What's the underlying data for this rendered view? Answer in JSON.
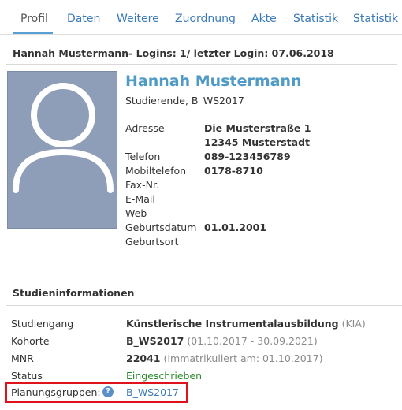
{
  "tabs": [
    {
      "label": "Profil",
      "active": true
    },
    {
      "label": "Daten"
    },
    {
      "label": "Weitere"
    },
    {
      "label": "Zuordnung"
    },
    {
      "label": "Akte"
    },
    {
      "label": "Statistik"
    },
    {
      "label": "Statistik"
    }
  ],
  "header": {
    "title": "Hannah Mustermann- Logins: 1/ letzter Login: 07.06.2018"
  },
  "profile": {
    "name": "Hannah Mustermann",
    "subtitle": "Studierende, B_WS2017",
    "avatar_icon": "user-silhouette-icon",
    "details": [
      {
        "label": "Adresse",
        "value": "Die Musterstraße 1"
      },
      {
        "label": "",
        "value": "12345 Musterstadt"
      },
      {
        "label": "Telefon",
        "value": "089-123456789"
      },
      {
        "label": "Mobiltelefon",
        "value": "0178-8710"
      },
      {
        "label": "Fax-Nr.",
        "value": ""
      },
      {
        "label": "E-Mail",
        "value": ""
      },
      {
        "label": "Web",
        "value": ""
      },
      {
        "label": "Geburtsdatum",
        "value": "01.01.2001"
      },
      {
        "label": "Geburtsort",
        "value": ""
      }
    ]
  },
  "studieninfo": {
    "title": "Studieninformationen",
    "studiengang": {
      "label": "Studiengang",
      "value": "Künstlerische Instrumentalausbildung",
      "extra": "(KIA)"
    },
    "kohorte": {
      "label": "Kohorte",
      "value": "B_WS2017",
      "extra": "(01.10.2017 - 30.09.2021)"
    },
    "mnr": {
      "label": "MNR",
      "value": "22041",
      "extra": "(Immatrikuliert am: 01.10.2017)"
    },
    "status": {
      "label": "Status",
      "value": "Eingeschrieben"
    },
    "planungsgruppen": {
      "label": "Planungsgruppen:",
      "help_icon": "question-help-icon",
      "help_glyph": "?",
      "value": "B_WS2017"
    }
  },
  "colors": {
    "link": "#3a7ab8",
    "name": "#4f9bc6",
    "status_green": "#2e8b2e",
    "highlight": "#e0131c",
    "avatar_bg": "#8e9db8"
  }
}
